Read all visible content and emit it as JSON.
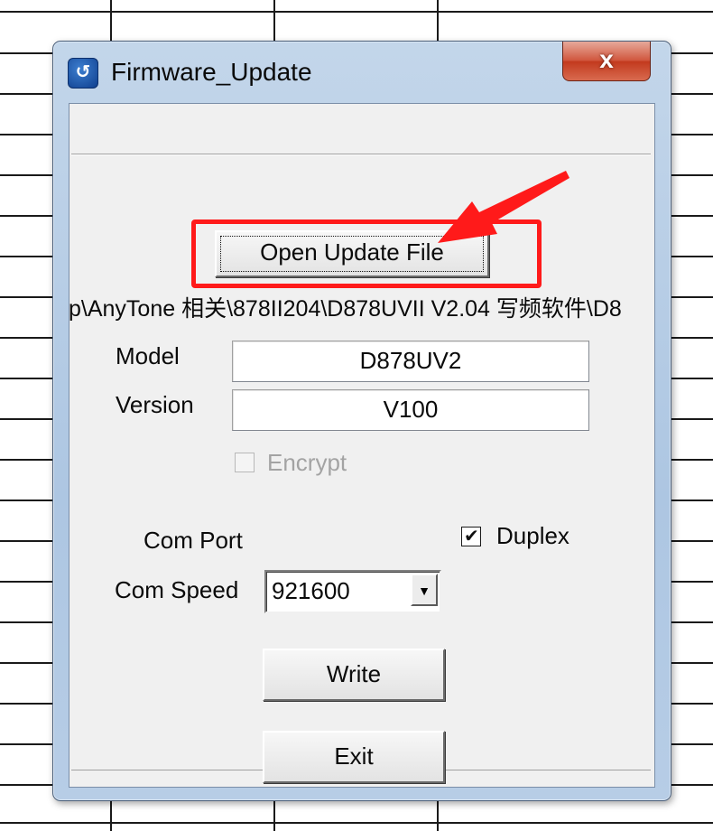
{
  "window": {
    "title": "Firmware_Update",
    "close_label": "x"
  },
  "buttons": {
    "open_update_file": "Open Update File",
    "write": "Write",
    "exit": "Exit"
  },
  "file_path": "p\\AnyTone 相关\\878II204\\D878UVII V2.04 写频软件\\D8",
  "fields": {
    "model_label": "Model",
    "model_value": "D878UV2",
    "version_label": "Version",
    "version_value": "V100",
    "encrypt_label": "Encrypt",
    "encrypt_checked": false,
    "encrypt_enabled": false
  },
  "com": {
    "port_label": "Com Port",
    "speed_label": "Com Speed",
    "speed_value": "921600",
    "duplex_label": "Duplex",
    "duplex_checked": true
  },
  "colors": {
    "annotation": "#ff1a1a",
    "dialog_background": "#f0f0f0",
    "frame": "#b7cde6"
  }
}
